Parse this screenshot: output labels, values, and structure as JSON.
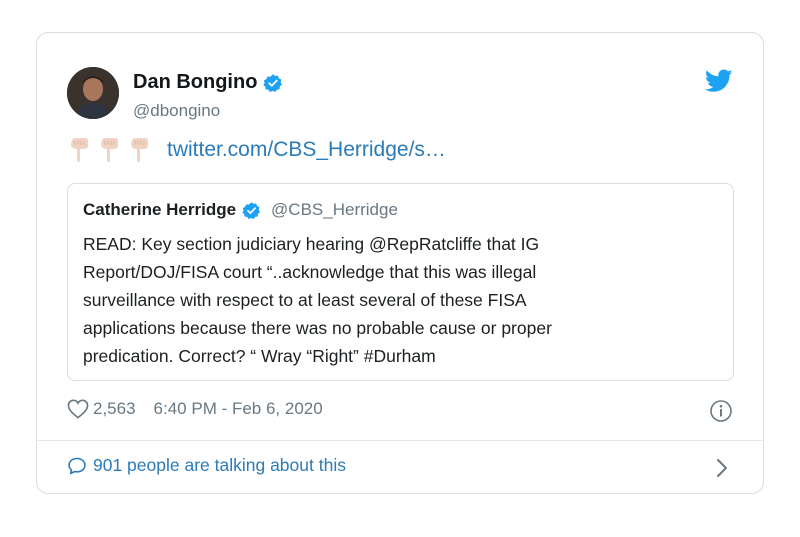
{
  "tweet": {
    "author_name": "Dan Bongino",
    "author_handle": "@dbongino",
    "emoji": [
      "👇🏻",
      "👇🏻",
      "👇🏻"
    ],
    "link_text": "twitter.com/CBS_Herridge/s…",
    "likes": "2,563",
    "timestamp": "6:40 PM - Feb 6, 2020",
    "talking_text": "901 people are talking about this"
  },
  "quoted": {
    "author_name": "Catherine Herridge",
    "author_handle": "@CBS_Herridge",
    "text_lines": [
      "READ: Key section judiciary hearing @RepRatcliffe that IG",
      "Report/DOJ/FISA court “..acknowledge that this was illegal",
      "surveillance with respect to at least several of these FISA",
      "applications because there was no probable cause or proper",
      "predication. Correct? “ Wray “Right” #Durham"
    ]
  },
  "icons": {
    "verified": "verified-badge-icon",
    "brand": "twitter-bird-icon",
    "like": "heart-icon",
    "info": "info-icon",
    "reply": "speech-bubble-icon",
    "more": "chevron-right-icon"
  },
  "colors": {
    "accent": "#1da1f2",
    "link": "#2b7bb9",
    "muted": "#697882",
    "border": "#d8dee3"
  }
}
